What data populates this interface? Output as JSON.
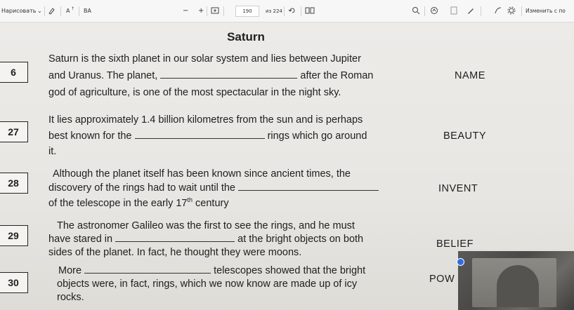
{
  "toolbar": {
    "draw_label": "Нарисовать",
    "text_size_label": "A",
    "lang_label": "ВА",
    "minus": "−",
    "plus": "+",
    "page_current": "190",
    "page_total": "из 224",
    "edit_label": "Изменить с по"
  },
  "worksheet": {
    "title": "Saturn",
    "q26": {
      "number": "6",
      "line1": "Saturn is the sixth planet in our solar system and lies between Jupiter",
      "line2a": "and Uranus. The planet,",
      "line2b": "after the Roman",
      "line3": "god of agriculture, is one of the most spectacular in the night sky.",
      "keyword": "NAME"
    },
    "q27": {
      "number": "27",
      "line1": "It lies approximately 1.4 billion kilometres from the sun and is perhaps",
      "line2a": "best known for the",
      "line2b": "rings which go around",
      "line3": "it.",
      "keyword": "BEAUTY"
    },
    "q28": {
      "number": "28",
      "line1": "Although the planet itself has been known since ancient times, the",
      "line2a": "discovery of the rings had to wait until the",
      "line3a": "of the telescope in the early 17",
      "line3sup": "th",
      "line3b": " century",
      "keyword": "INVENT"
    },
    "q29": {
      "number": "29",
      "line1": "The astronomer Galileo was the first to see the rings, and he must",
      "line2a": "have stared in",
      "line2b": "at the bright objects on both",
      "line3": "sides of the planet. In fact, he thought they were moons.",
      "keyword": "BELIEF"
    },
    "q30": {
      "number": "30",
      "line1a": "More",
      "line1b": "telescopes showed that the bright",
      "line2": "objects were, in fact, rings, which we now know are made up of icy",
      "line3": "rocks.",
      "keyword": "POW"
    }
  },
  "colors": {
    "accent": "#2f6de6"
  }
}
